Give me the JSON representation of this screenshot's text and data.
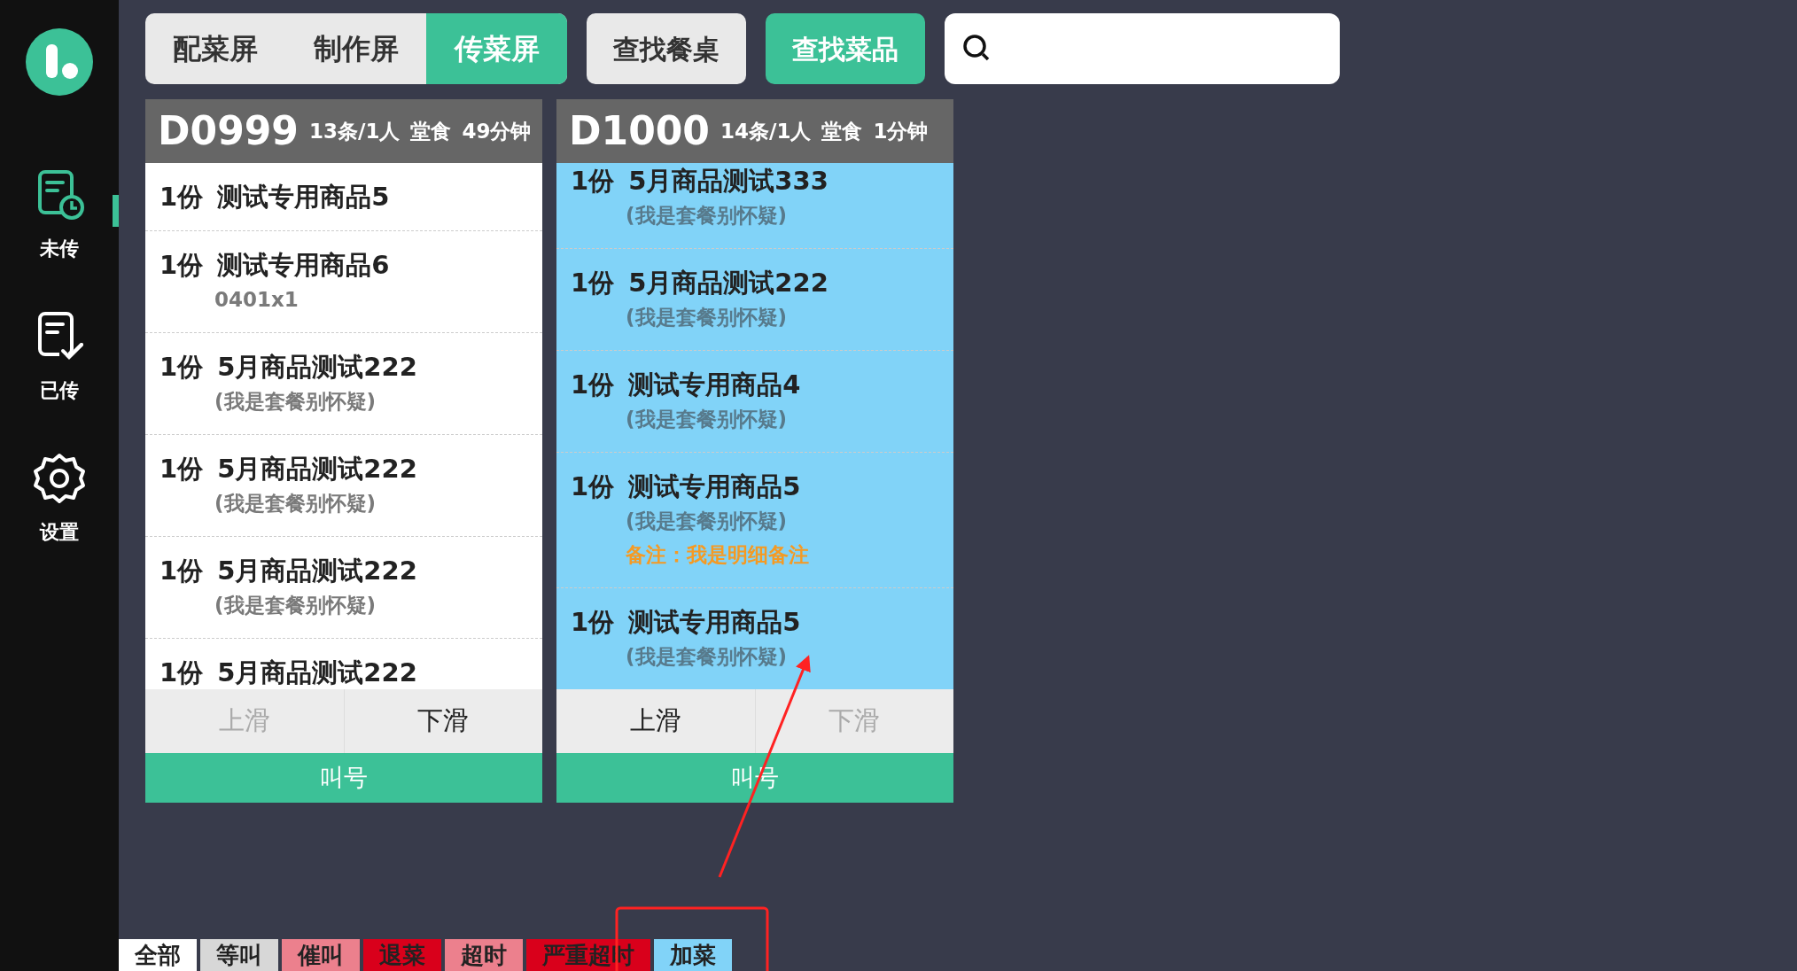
{
  "sidebar": {
    "items": [
      {
        "label": "未传",
        "kind": "pending",
        "selected": true
      },
      {
        "label": "已传",
        "kind": "sent",
        "selected": false
      },
      {
        "label": "设置",
        "kind": "settings",
        "selected": false
      }
    ]
  },
  "screen_tabs": [
    {
      "label": "配菜屏",
      "selected": false
    },
    {
      "label": "制作屏",
      "selected": false
    },
    {
      "label": "传菜屏",
      "selected": true
    }
  ],
  "find_buttons": [
    {
      "label": "查找餐桌",
      "selected": false
    },
    {
      "label": "查找菜品",
      "selected": true
    }
  ],
  "orders": [
    {
      "table": "D0999",
      "meta": [
        "13条/1人",
        "堂食",
        "49分钟"
      ],
      "color": "#ffffff",
      "items": [
        {
          "qty": "1份",
          "name": "测试专用商品5"
        },
        {
          "qty": "1份",
          "name": "测试专用商品6",
          "lines": [
            {
              "kind": "detail",
              "text": "0401x1"
            }
          ]
        },
        {
          "qty": "1份",
          "name": "5月商品测试222",
          "lines": [
            {
              "kind": "detail",
              "text": "(我是套餐别怀疑)"
            }
          ]
        },
        {
          "qty": "1份",
          "name": "5月商品测试222",
          "lines": [
            {
              "kind": "detail",
              "text": "(我是套餐别怀疑)"
            }
          ]
        },
        {
          "qty": "1份",
          "name": "5月商品测试222",
          "lines": [
            {
              "kind": "detail",
              "text": "(我是套餐别怀疑)"
            }
          ]
        },
        {
          "qty": "1份",
          "name": "5月商品测试222"
        }
      ],
      "scroll_up": {
        "label": "上滑",
        "disabled": true
      },
      "scroll_down": {
        "label": "下滑",
        "disabled": false
      },
      "call": "叫号"
    },
    {
      "table": "D1000",
      "meta": [
        "14条/1人",
        "堂食",
        "1分钟"
      ],
      "color": "#81d3f8",
      "items": [
        {
          "qty": "1份",
          "name": "5月商品测试333",
          "lines": [
            {
              "kind": "detail",
              "text": "(我是套餐别怀疑)"
            }
          ]
        },
        {
          "qty": "1份",
          "name": "5月商品测试222",
          "lines": [
            {
              "kind": "detail",
              "text": "(我是套餐别怀疑)"
            }
          ]
        },
        {
          "qty": "1份",
          "name": "测试专用商品4",
          "lines": [
            {
              "kind": "detail",
              "text": "(我是套餐别怀疑)"
            }
          ]
        },
        {
          "qty": "1份",
          "name": "测试专用商品5",
          "lines": [
            {
              "kind": "detail",
              "text": "(我是套餐别怀疑)"
            },
            {
              "kind": "note",
              "text": "备注：我是明细备注"
            }
          ]
        },
        {
          "qty": "1份",
          "name": "测试专用商品5",
          "lines": [
            {
              "kind": "detail",
              "text": "(我是套餐别怀疑)"
            }
          ]
        }
      ],
      "scroll_up": {
        "label": "上滑",
        "disabled": false
      },
      "scroll_down": {
        "label": "下滑",
        "disabled": true
      },
      "call": "叫号"
    }
  ],
  "filters": [
    {
      "label": "全部",
      "color": "#ffffff"
    },
    {
      "label": "等叫",
      "color": "#d7d7d7"
    },
    {
      "label": "催叫",
      "color": "#ec808d"
    },
    {
      "label": "退菜",
      "color": "#d9001b"
    },
    {
      "label": "超时",
      "color": "#ec808d"
    },
    {
      "label": "严重超时",
      "color": "#d9001b"
    },
    {
      "label": "加菜",
      "color": "#81d3f8"
    }
  ]
}
